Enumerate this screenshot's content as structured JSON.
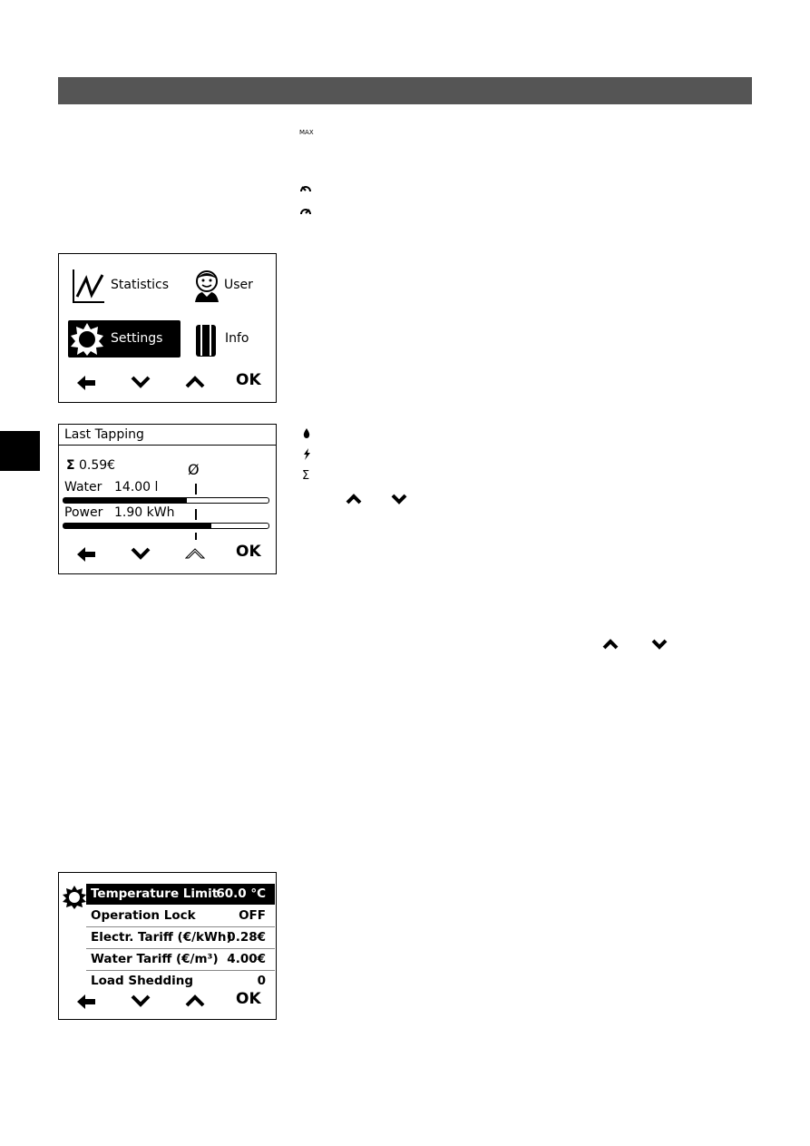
{
  "side_icons": {
    "max_label": "MAX"
  },
  "menu_screen": {
    "items": [
      {
        "label": "Statistics",
        "icon": "chart-line-icon"
      },
      {
        "label": "User",
        "icon": "user-face-icon"
      },
      {
        "label": "Settings",
        "icon": "gear-icon",
        "selected": true
      },
      {
        "label": "Info",
        "icon": "info-device-icon"
      }
    ],
    "nav": {
      "ok": "OK"
    }
  },
  "tapping_screen": {
    "title": "Last Tapping",
    "sigma": "Σ",
    "cost": "0.59€",
    "avg_symbol": "Ø",
    "water_label": "Water",
    "water_value": "14.00 l",
    "water_fill": 0.6,
    "power_label": "Power",
    "power_value": "1.90 kWh",
    "power_fill": 0.72,
    "nav": {
      "ok": "OK"
    }
  },
  "tapping_legend": {
    "sigma": "Σ"
  },
  "settings_screen": {
    "rows": [
      {
        "label": "Temperature Limit",
        "value": "60.0 °C",
        "selected": true
      },
      {
        "label": "Operation Lock",
        "value": "OFF"
      },
      {
        "label": "Electr. Tariff (€/kWh)",
        "value": "0.28€"
      },
      {
        "label": "Water Tariff (€/m³)",
        "value": "4.00€"
      },
      {
        "label": "Load Shedding",
        "value": "0"
      }
    ],
    "nav": {
      "ok": "OK"
    }
  },
  "colors": {
    "header_bar": "#555555",
    "tab": "#000000"
  }
}
